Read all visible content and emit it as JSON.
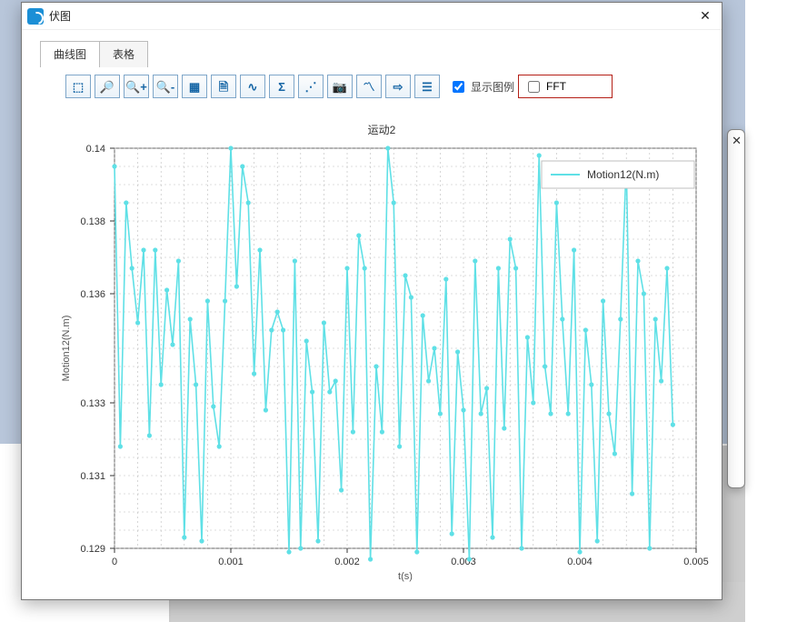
{
  "window": {
    "title": "伏图",
    "close_glyph": "✕"
  },
  "tabs": {
    "curve": "曲线图",
    "table": "表格"
  },
  "toolbar": {
    "home": "⤧",
    "zoom_box": "🔍",
    "zoom_in": "＋",
    "zoom_out": "－",
    "grid": "▦",
    "save": "🗎",
    "line": "∿",
    "sigma": "Σ",
    "scatter": "⋮⋮",
    "camera": "📷",
    "curve2": "〽",
    "export": "⇨",
    "settings": "☰",
    "show_legend": "显示图例",
    "fft": "FFT"
  },
  "panel_right_close": "✕",
  "chart_data": {
    "type": "line",
    "title": "运动2",
    "xlabel": "t(s)",
    "ylabel": "Motion12(N.m)",
    "xlim": [
      0,
      0.005
    ],
    "ylim": [
      0.129,
      0.14
    ],
    "x_ticks": [
      0,
      0.001,
      0.002,
      0.003,
      0.004,
      0.005
    ],
    "y_ticks": [
      0.129,
      0.131,
      0.133,
      0.136,
      0.138,
      0.14
    ],
    "legend": "Motion12(N.m)",
    "x": [
      0.0,
      5e-05,
      0.0001,
      0.00015,
      0.0002,
      0.00025,
      0.0003,
      0.00035,
      0.0004,
      0.00045,
      0.0005,
      0.00055,
      0.0006,
      0.00065,
      0.0007,
      0.00075,
      0.0008,
      0.00085,
      0.0009,
      0.00095,
      0.001,
      0.00105,
      0.0011,
      0.00115,
      0.0012,
      0.00125,
      0.0013,
      0.00135,
      0.0014,
      0.00145,
      0.0015,
      0.00155,
      0.0016,
      0.00165,
      0.0017,
      0.00175,
      0.0018,
      0.00185,
      0.0019,
      0.00195,
      0.002,
      0.00205,
      0.0021,
      0.00215,
      0.0022,
      0.00225,
      0.0023,
      0.00235,
      0.0024,
      0.00245,
      0.0025,
      0.00255,
      0.0026,
      0.00265,
      0.0027,
      0.00275,
      0.0028,
      0.00285,
      0.0029,
      0.00295,
      0.003,
      0.00305,
      0.0031,
      0.00315,
      0.0032,
      0.00325,
      0.0033,
      0.00335,
      0.0034,
      0.00345,
      0.0035,
      0.00355,
      0.0036,
      0.00365,
      0.0037,
      0.00375,
      0.0038,
      0.00385,
      0.0039,
      0.00395,
      0.004,
      0.00405,
      0.0041,
      0.00415,
      0.0042,
      0.00425,
      0.0043,
      0.00435,
      0.0044,
      0.00445,
      0.0045,
      0.00455,
      0.0046,
      0.00465,
      0.0047,
      0.00475,
      0.0048
    ],
    "y": [
      0.1395,
      0.1318,
      0.1385,
      0.1367,
      0.1352,
      0.1372,
      0.1321,
      0.1372,
      0.1335,
      0.1361,
      0.1346,
      0.1369,
      0.1293,
      0.1353,
      0.1335,
      0.1292,
      0.1358,
      0.1329,
      0.1318,
      0.1358,
      0.14,
      0.1362,
      0.1395,
      0.1385,
      0.1338,
      0.1372,
      0.1328,
      0.135,
      0.1355,
      0.135,
      0.1289,
      0.1369,
      0.129,
      0.1347,
      0.1333,
      0.1292,
      0.1352,
      0.1333,
      0.1336,
      0.1306,
      0.1367,
      0.1322,
      0.1376,
      0.1367,
      0.1287,
      0.134,
      0.1322,
      0.14,
      0.1385,
      0.1318,
      0.1365,
      0.1359,
      0.1289,
      0.1354,
      0.1336,
      0.1345,
      0.1327,
      0.1364,
      0.1294,
      0.1344,
      0.1328,
      0.1287,
      0.1369,
      0.1327,
      0.1334,
      0.1293,
      0.1367,
      0.1323,
      0.1375,
      0.1367,
      0.129,
      0.1348,
      0.133,
      0.1398,
      0.134,
      0.1327,
      0.1385,
      0.1353,
      0.1327,
      0.1372,
      0.1289,
      0.135,
      0.1335,
      0.1292,
      0.1358,
      0.1327,
      0.1316,
      0.1353,
      0.1396,
      0.1305,
      0.1369,
      0.136,
      0.129,
      0.1353,
      0.1336,
      0.1367,
      0.1324
    ]
  }
}
